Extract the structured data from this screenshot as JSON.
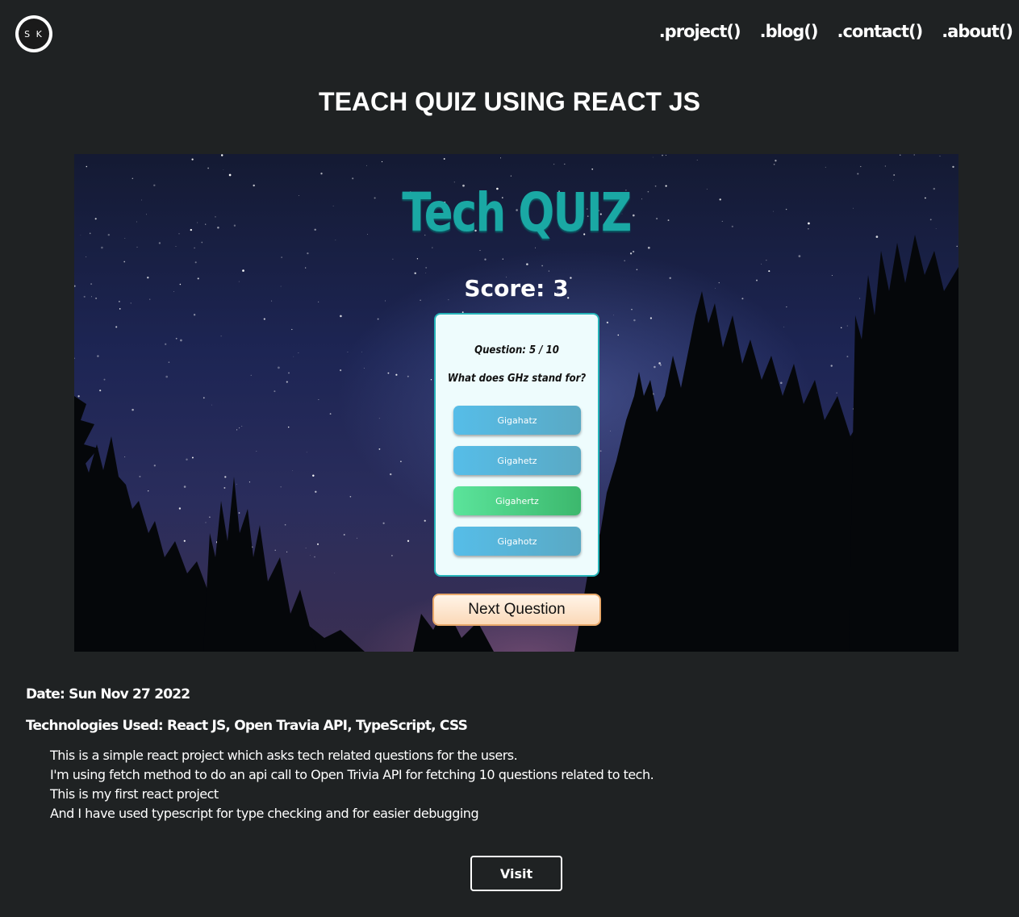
{
  "header": {
    "logo_text": "S K",
    "nav": [
      ".project()",
      ".blog()",
      ".contact()",
      ".about()"
    ]
  },
  "page_title": "TEACH QUIZ USING REACT JS",
  "screenshot": {
    "app_title": "Tech QUIZ",
    "score": "Score: 3",
    "question_number": "Question: 5 / 10",
    "question": "What does GHz stand for?",
    "answers": [
      "Gigahatz",
      "Gigahetz",
      "Gigahertz",
      "Gigahotz"
    ],
    "correct_answer_index": 2,
    "next_button": "Next Question"
  },
  "details": {
    "date": "Date: Sun Nov 27 2022",
    "technologies": "Technologies Used: React JS, Open Travia API, TypeScript, CSS",
    "description": [
      "This is a simple react project which asks tech related questions for the users.",
      "I'm using fetch method to do an api call to Open Trivia API for fetching 10 questions related to tech.",
      "This is my first react project",
      "And I have used typescript for type checking and for easier debugging"
    ],
    "visit_button": "Visit"
  },
  "colors": {
    "background": "#1f2223",
    "quiz_title": "#1aa8a4",
    "answer_default": "#56bde8",
    "answer_correct": "#5be49b",
    "next_button": "#fbd9b8"
  }
}
